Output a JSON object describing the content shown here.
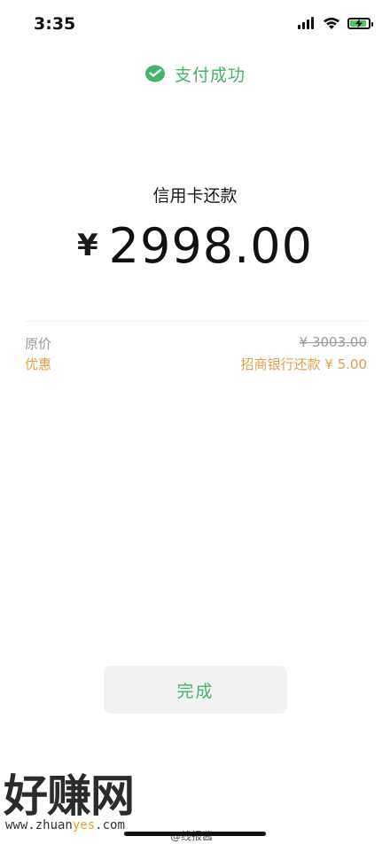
{
  "status_bar": {
    "time": "3:35",
    "icons": [
      "signal-icon",
      "wifi-icon",
      "battery-charging-icon"
    ],
    "battery_level": 0.8
  },
  "header": {
    "icon": "wechat-pay-icon",
    "text": "支付成功",
    "color": "#47b26b"
  },
  "payment": {
    "title": "信用卡还款",
    "currency": "¥",
    "amount": "2998.00"
  },
  "details": {
    "original_label": "原价",
    "original_value": "¥ 3003.00",
    "discount_label": "优惠",
    "discount_value": "招商银行还款 ¥ 5.00",
    "discount_color": "#e0a050"
  },
  "actions": {
    "done_label": "完成"
  },
  "watermark": {
    "title": "好赚网",
    "url_prefix": "www.zhuan",
    "url_highlight": "yes",
    "url_suffix": ".com",
    "weibo": "@线报酱"
  }
}
